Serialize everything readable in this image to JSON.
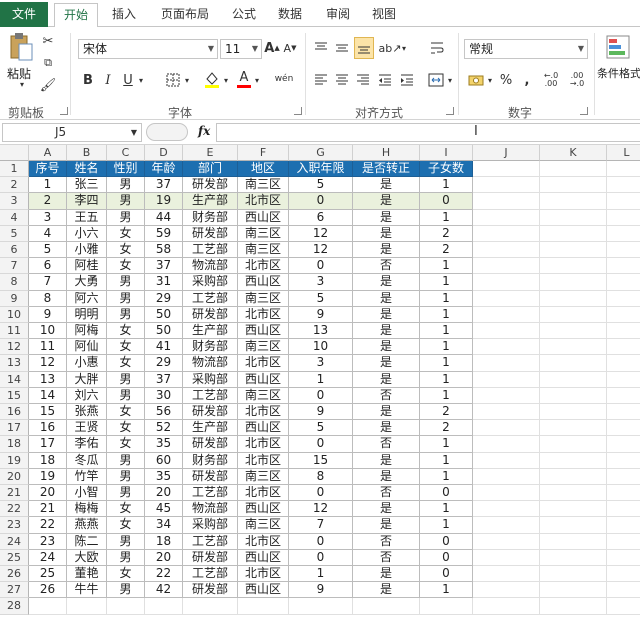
{
  "tabs": {
    "file": "文件",
    "home": "开始",
    "insert": "插入",
    "layout": "页面布局",
    "formula": "公式",
    "data": "数据",
    "review": "审阅",
    "view": "视图"
  },
  "ribbon": {
    "clipboard": {
      "paste": "粘贴",
      "label": "剪贴板"
    },
    "font": {
      "name": "宋体",
      "size": "11",
      "bold": "B",
      "italic": "I",
      "underline": "U",
      "font_color": "A",
      "phonetic": "wén",
      "label": "字体"
    },
    "align": {
      "label": "对齐方式"
    },
    "number": {
      "format": "常规",
      "percent": "%",
      "comma": ",",
      "inc": "←.0 .00",
      "dec": ".00 →.0",
      "label": "数字"
    },
    "styles": {
      "cond": "条件格式"
    }
  },
  "formula_bar": {
    "name_box": "J5",
    "fx": "fx",
    "value": ""
  },
  "columns": [
    "A",
    "B",
    "C",
    "D",
    "E",
    "F",
    "G",
    "H",
    "I",
    "J",
    "K",
    "L"
  ],
  "rows": [
    "1",
    "2",
    "3",
    "4",
    "5",
    "6",
    "7",
    "8",
    "9",
    "10",
    "11",
    "12",
    "13",
    "14",
    "15",
    "16",
    "17",
    "18",
    "19",
    "20",
    "21",
    "22",
    "23",
    "24",
    "25",
    "26",
    "27",
    "28"
  ],
  "table": {
    "headers": [
      "序号",
      "姓名",
      "性别",
      "年龄",
      "部门",
      "地区",
      "入职年限",
      "是否转正",
      "子女数"
    ],
    "data": [
      [
        "1",
        "张三",
        "男",
        "37",
        "研发部",
        "南三区",
        "5",
        "是",
        "1"
      ],
      [
        "2",
        "李四",
        "男",
        "19",
        "生产部",
        "北市区",
        "0",
        "是",
        "0"
      ],
      [
        "3",
        "王五",
        "男",
        "44",
        "财务部",
        "西山区",
        "6",
        "是",
        "1"
      ],
      [
        "4",
        "小六",
        "女",
        "59",
        "研发部",
        "南三区",
        "12",
        "是",
        "2"
      ],
      [
        "5",
        "小雅",
        "女",
        "58",
        "工艺部",
        "南三区",
        "12",
        "是",
        "2"
      ],
      [
        "6",
        "阿桂",
        "女",
        "37",
        "物流部",
        "北市区",
        "0",
        "否",
        "1"
      ],
      [
        "7",
        "大勇",
        "男",
        "31",
        "采购部",
        "西山区",
        "3",
        "是",
        "1"
      ],
      [
        "8",
        "阿六",
        "男",
        "29",
        "工艺部",
        "南三区",
        "5",
        "是",
        "1"
      ],
      [
        "9",
        "明明",
        "男",
        "50",
        "研发部",
        "北市区",
        "9",
        "是",
        "1"
      ],
      [
        "10",
        "阿梅",
        "女",
        "50",
        "生产部",
        "西山区",
        "13",
        "是",
        "1"
      ],
      [
        "11",
        "阿仙",
        "女",
        "41",
        "财务部",
        "南三区",
        "10",
        "是",
        "1"
      ],
      [
        "12",
        "小惠",
        "女",
        "29",
        "物流部",
        "北市区",
        "3",
        "是",
        "1"
      ],
      [
        "13",
        "大胖",
        "男",
        "37",
        "采购部",
        "西山区",
        "1",
        "是",
        "1"
      ],
      [
        "14",
        "刘六",
        "男",
        "30",
        "工艺部",
        "南三区",
        "0",
        "否",
        "1"
      ],
      [
        "15",
        "张燕",
        "女",
        "56",
        "研发部",
        "北市区",
        "9",
        "是",
        "2"
      ],
      [
        "16",
        "王贤",
        "女",
        "52",
        "生产部",
        "西山区",
        "5",
        "是",
        "2"
      ],
      [
        "17",
        "李佑",
        "女",
        "35",
        "研发部",
        "北市区",
        "0",
        "否",
        "1"
      ],
      [
        "18",
        "冬瓜",
        "男",
        "60",
        "财务部",
        "北市区",
        "15",
        "是",
        "1"
      ],
      [
        "19",
        "竹竿",
        "男",
        "35",
        "研发部",
        "南三区",
        "8",
        "是",
        "1"
      ],
      [
        "20",
        "小智",
        "男",
        "20",
        "工艺部",
        "北市区",
        "0",
        "否",
        "0"
      ],
      [
        "21",
        "梅梅",
        "女",
        "45",
        "物流部",
        "西山区",
        "12",
        "是",
        "1"
      ],
      [
        "22",
        "燕燕",
        "女",
        "34",
        "采购部",
        "南三区",
        "7",
        "是",
        "1"
      ],
      [
        "23",
        "陈二",
        "男",
        "18",
        "工艺部",
        "北市区",
        "0",
        "否",
        "0"
      ],
      [
        "24",
        "大欧",
        "男",
        "20",
        "研发部",
        "西山区",
        "0",
        "否",
        "0"
      ],
      [
        "25",
        "董艳",
        "女",
        "22",
        "工艺部",
        "北市区",
        "1",
        "是",
        "0"
      ],
      [
        "26",
        "牛牛",
        "男",
        "42",
        "研发部",
        "西山区",
        "9",
        "是",
        "1"
      ]
    ]
  },
  "colors": {
    "accent": "#217346",
    "header_fill": "#1d6fb0",
    "highlight_row": "#eaf1dd"
  }
}
